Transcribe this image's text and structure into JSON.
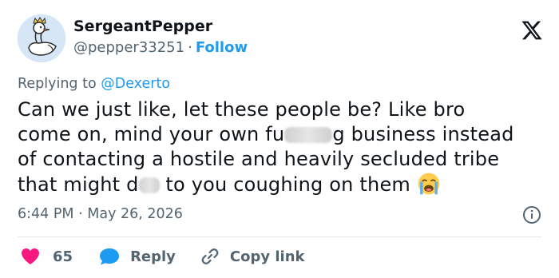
{
  "user": {
    "display_name": "SergeantPepper",
    "handle": "@pepper33251",
    "separator": "·",
    "follow_label": "Follow"
  },
  "reply": {
    "prefix": "Replying to",
    "target": "@Dexerto"
  },
  "tweet": {
    "line1": "Can we just like, let these people be? Like bro",
    "line2_before": "come on, mind your own fu",
    "line2_after": "g business instead",
    "line3": "of contacting a hostile and heavily secluded tribe",
    "line4_before": "that might d",
    "line4_after": " to you coughing on them",
    "emoji": "loudly-crying-face-emoji"
  },
  "meta": {
    "time": "6:44 PM",
    "separator": "·",
    "date": "May 26, 2026"
  },
  "actions": {
    "like_count": "65",
    "reply_label": "Reply",
    "copy_label": "Copy link"
  },
  "colors": {
    "accent": "#1d9bf0",
    "like": "#f91880",
    "muted": "#536471",
    "text": "#0f1419"
  },
  "icons": [
    "goose-avatar",
    "x-logo-icon",
    "info-icon",
    "heart-icon",
    "reply-bubble-icon",
    "link-icon"
  ]
}
